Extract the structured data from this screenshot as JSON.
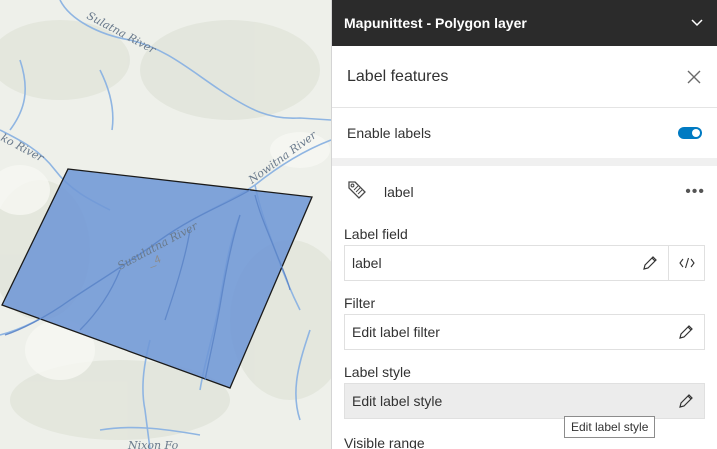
{
  "map": {
    "rivers": [
      "Sulatna River",
      "Nowitna River",
      "Susulatna River",
      "ko River",
      "Nixon Fo"
    ],
    "polygon_label": "_4",
    "colors": {
      "polygon_fill": "#6f97d6",
      "polygon_stroke": "#1a1a1a",
      "river": "#8fb5e2",
      "land": "#eef0ea"
    }
  },
  "layer_header": {
    "title": "Mapunittest - Polygon layer",
    "icon": "chevron-down-icon"
  },
  "panel": {
    "title": "Label features",
    "close_icon": "close-icon",
    "enable_labels": {
      "label": "Enable labels",
      "enabled": true
    },
    "label_class": {
      "name": "label",
      "icon": "label-tag-icon",
      "menu_icon": "ellipsis-icon"
    },
    "fields": {
      "label_field": {
        "heading": "Label field",
        "value": "label"
      },
      "filter": {
        "heading": "Filter",
        "value": "Edit label filter"
      },
      "label_style": {
        "heading": "Label style",
        "value": "Edit label style"
      },
      "visible_range": {
        "heading": "Visible range"
      }
    },
    "tooltip": "Edit label style"
  },
  "accent_color": "#007ac2"
}
